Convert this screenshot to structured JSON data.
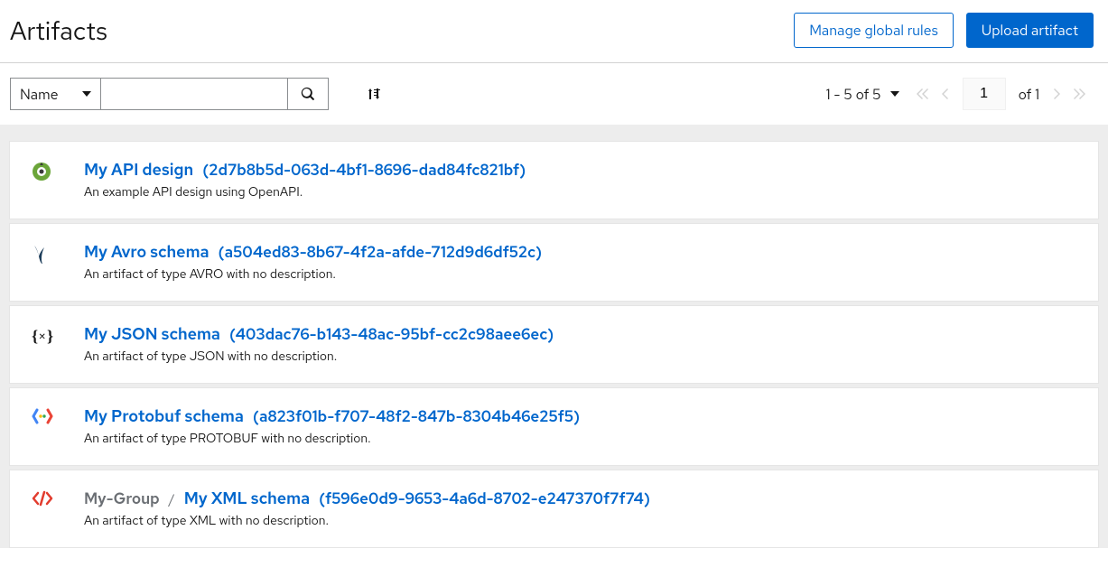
{
  "header": {
    "title": "Artifacts",
    "manage_rules": "Manage global rules",
    "upload": "Upload artifact"
  },
  "toolbar": {
    "filter_field": "Name",
    "search_value": "",
    "range": "1 - 5 of 5",
    "page_value": "1",
    "of_text": "of 1"
  },
  "artifacts": [
    {
      "icon": "openapi",
      "group": "",
      "name": "My API design",
      "id": "(2d7b8b5d-063d-4bf1-8696-dad84fc821bf)",
      "desc": "An example API design using OpenAPI."
    },
    {
      "icon": "avro",
      "group": "",
      "name": "My Avro schema",
      "id": "(a504ed83-8b67-4f2a-afde-712d9d6df52c)",
      "desc": "An artifact of type AVRO with no description."
    },
    {
      "icon": "json",
      "group": "",
      "name": "My JSON schema",
      "id": "(403dac76-b143-48ac-95bf-cc2c98aee6ec)",
      "desc": "An artifact of type JSON with no description."
    },
    {
      "icon": "protobuf",
      "group": "",
      "name": "My Protobuf schema",
      "id": "(a823f01b-f707-48f2-847b-8304b46e25f5)",
      "desc": "An artifact of type PROTOBUF with no description."
    },
    {
      "icon": "xml",
      "group": "My-Group",
      "name": "My XML schema",
      "id": "(f596e0d9-9653-4a6d-8702-e247370f7f74)",
      "desc": "An artifact of type XML with no description."
    }
  ]
}
